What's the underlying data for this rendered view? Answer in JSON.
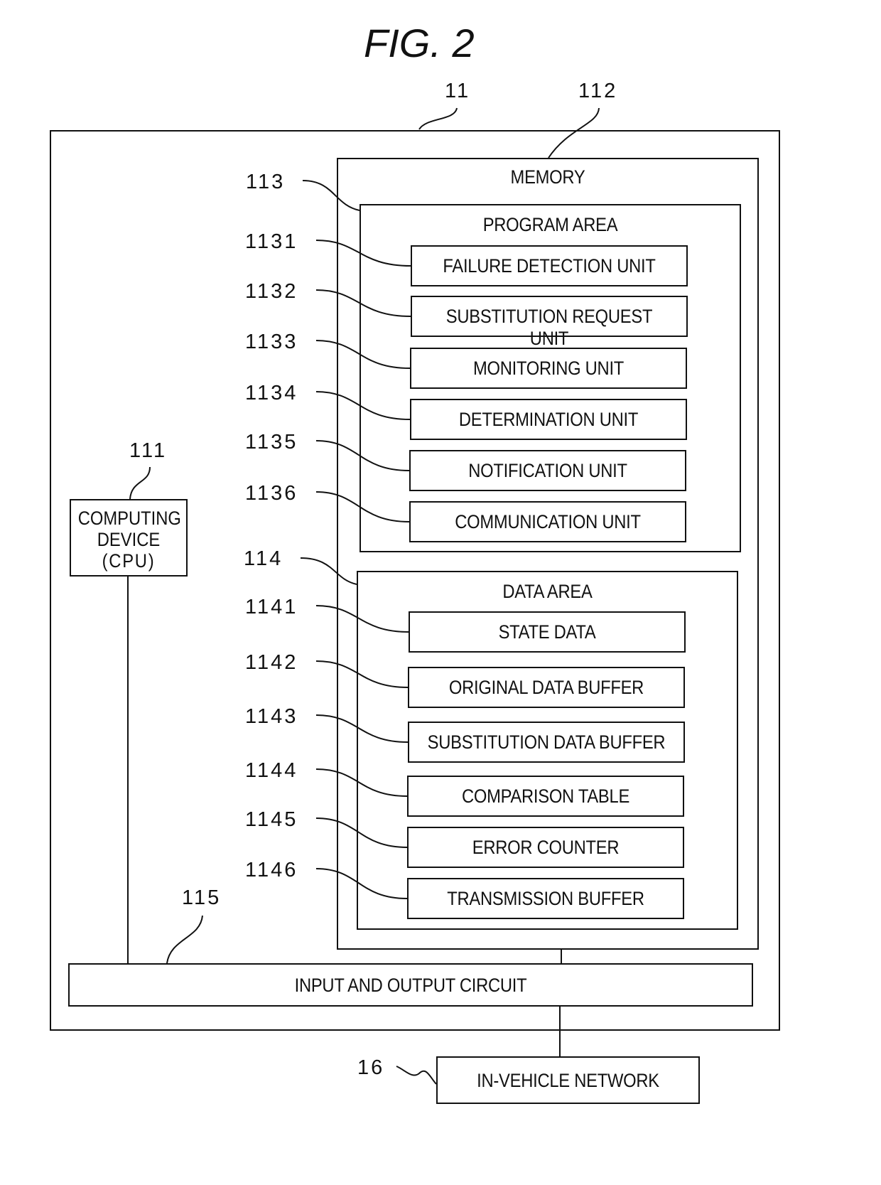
{
  "figure": {
    "title": "FIG. 2"
  },
  "ecu": {
    "ref": "11"
  },
  "memory": {
    "ref": "112",
    "label": "MEMORY"
  },
  "cpu": {
    "ref": "111",
    "lines": [
      "COMPUTING",
      "DEVICE",
      "(CPU)"
    ]
  },
  "program_area": {
    "ref": "113",
    "label": "PROGRAM AREA",
    "units": [
      {
        "ref": "1131",
        "label": "FAILURE DETECTION UNIT"
      },
      {
        "ref": "1132",
        "label": "SUBSTITUTION REQUEST UNIT"
      },
      {
        "ref": "1133",
        "label": "MONITORING UNIT"
      },
      {
        "ref": "1134",
        "label": "DETERMINATION UNIT"
      },
      {
        "ref": "1135",
        "label": "NOTIFICATION UNIT"
      },
      {
        "ref": "1136",
        "label": "COMMUNICATION UNIT"
      }
    ]
  },
  "data_area": {
    "ref": "114",
    "label": "DATA AREA",
    "items": [
      {
        "ref": "1141",
        "label": "STATE DATA"
      },
      {
        "ref": "1142",
        "label": "ORIGINAL DATA BUFFER"
      },
      {
        "ref": "1143",
        "label": "SUBSTITUTION DATA BUFFER"
      },
      {
        "ref": "1144",
        "label": "COMPARISON TABLE"
      },
      {
        "ref": "1145",
        "label": "ERROR COUNTER"
      },
      {
        "ref": "1146",
        "label": "TRANSMISSION BUFFER"
      }
    ]
  },
  "io_circuit": {
    "ref": "115",
    "label": "INPUT AND OUTPUT CIRCUIT"
  },
  "network": {
    "ref": "16",
    "label": "IN-VEHICLE NETWORK"
  }
}
